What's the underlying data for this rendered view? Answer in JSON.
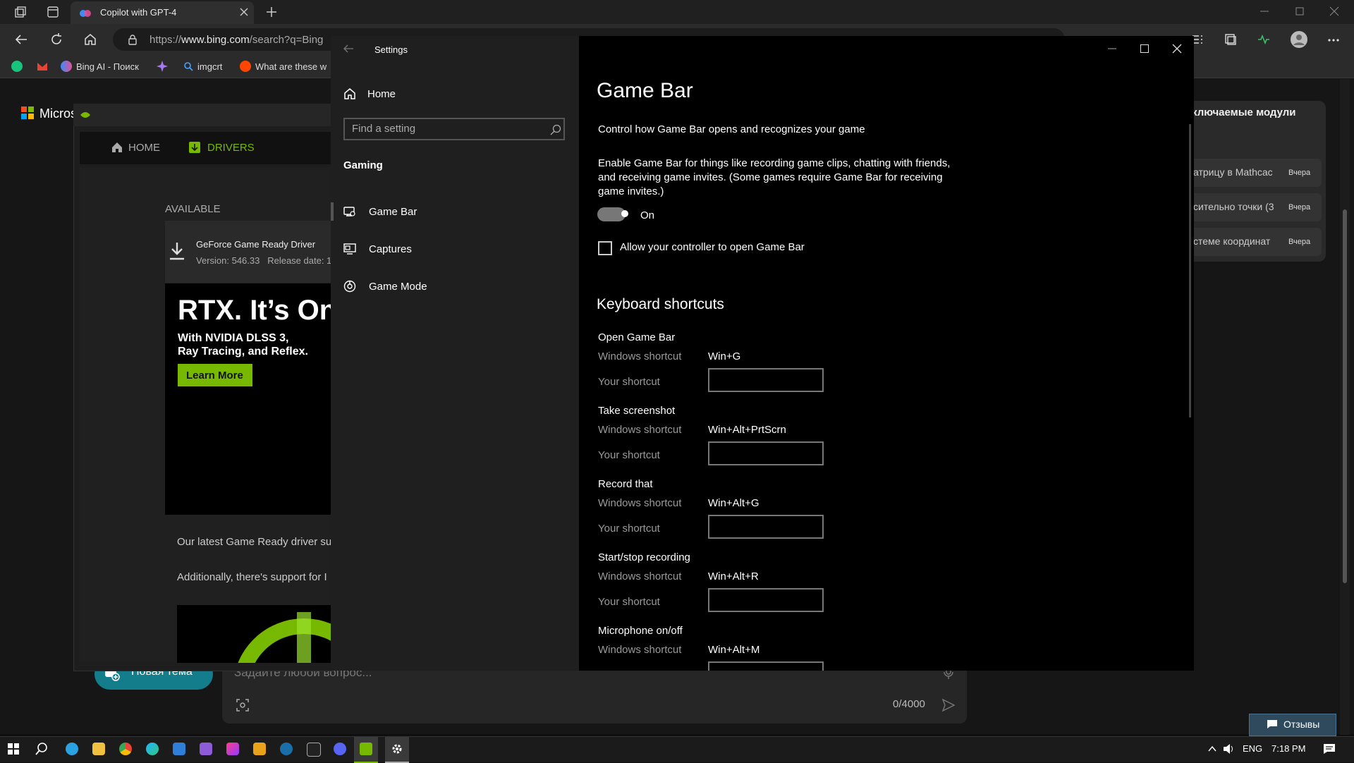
{
  "browser": {
    "tab_title": "Copilot with GPT-4",
    "url_prefix": "https://",
    "url_domain": "www.bing.com",
    "url_rest": "/search?q=Bing",
    "favorites": [
      {
        "label": ""
      },
      {
        "label": ""
      },
      {
        "label": "Bing AI - Поиск"
      },
      {
        "label": ""
      },
      {
        "label": "imgcrt"
      },
      {
        "label": "What are these w"
      }
    ]
  },
  "page": {
    "brand": "Micros",
    "right_header": "ключаемые модули",
    "history": [
      {
        "text": "атрицу в Mathcac",
        "date": "Вчера"
      },
      {
        "text": "сительно точки (3",
        "date": "Вчера"
      },
      {
        "text": "стеме координат",
        "date": "Вчера"
      }
    ],
    "new_topic": "Новая тема",
    "chat_placeholder": "Задайте любой вопрос...",
    "counter": "0/4000",
    "feedback": "Отзывы"
  },
  "nvidia": {
    "nav_home": "HOME",
    "nav_drivers": "DRIVERS",
    "available": "AVAILABLE",
    "driver_title": "GeForce Game Ready Driver",
    "driver_version": "Version: 546.33",
    "driver_release": "Release date: 1",
    "banner_title": "RTX. It’s On",
    "banner_line1": "With NVIDIA DLSS 3,",
    "banner_line2": "Ray Tracing, and Reflex.",
    "learn_more": "Learn More",
    "desc1": "Our latest Game Ready driver su",
    "desc2": "Additionally, there's support for I",
    "accent": "#76b900"
  },
  "settings": {
    "window_title": "Settings",
    "home": "Home",
    "search_placeholder": "Find a setting",
    "category": "Gaming",
    "nav": [
      "Game Bar",
      "Captures",
      "Game Mode"
    ],
    "title": "Game Bar",
    "subtitle": "Control how Game Bar opens and recognizes your game",
    "enable_desc": "Enable Game Bar for things like recording game clips, chatting with friends, and receiving game invites. (Some games require Game Bar for receiving game invites.)",
    "toggle_label": "On",
    "controller_label": "Allow your controller to open Game Bar",
    "shortcuts_heading": "Keyboard shortcuts",
    "windows_shortcut_label": "Windows shortcut",
    "your_shortcut_label": "Your shortcut",
    "shortcuts": [
      {
        "name": "Open Game Bar",
        "windows": "Win+G"
      },
      {
        "name": "Take screenshot",
        "windows": "Win+Alt+PrtScrn"
      },
      {
        "name": "Record that",
        "windows": "Win+Alt+G"
      },
      {
        "name": "Start/stop recording",
        "windows": "Win+Alt+R"
      },
      {
        "name": "Microphone on/off",
        "windows": "Win+Alt+M"
      }
    ]
  },
  "taskbar": {
    "lang": "ENG",
    "time": "7:18 PM"
  }
}
